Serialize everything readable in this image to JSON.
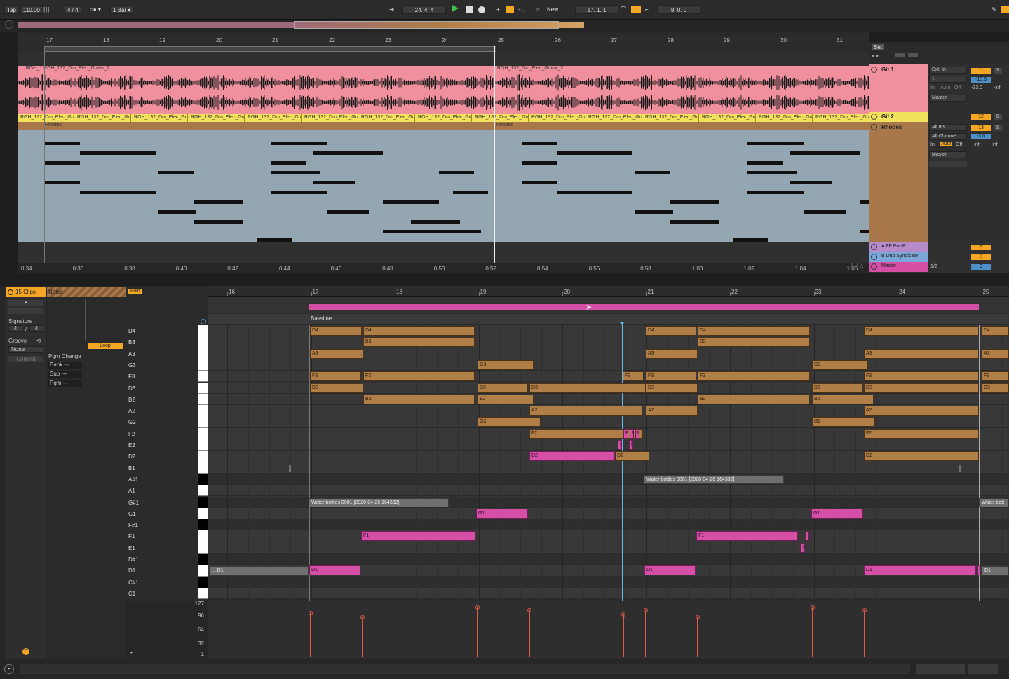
{
  "transport": {
    "tap": "Tap",
    "tempo": "110.00",
    "signature": "4 / 4",
    "quantize": "1 Bar",
    "position": "24.  4.  4",
    "new_label": "New",
    "loop_start": "17.  1.  1",
    "loop_length": "8.  0.  0"
  },
  "arrangement": {
    "bar_labels": [
      "17",
      "18",
      "19",
      "20",
      "21",
      "22",
      "23",
      "24",
      "25",
      "26",
      "27",
      "28",
      "29",
      "30",
      "31"
    ],
    "time_labels": [
      "0:34",
      "0:36",
      "0:38",
      "0:40",
      "0:42",
      "0:44",
      "0:46",
      "0:48",
      "0:50",
      "0:52",
      "0:54",
      "0:56",
      "0:58",
      "1:00",
      "1:02",
      "1:04",
      "1:06"
    ],
    "page_indicator": "1 / 4",
    "tracks": [
      {
        "name": "Git 1",
        "clip_label_a": "... RGH_1 RGH_132_Dm_Elec_Guitar_2",
        "clip_label_b": "RGH_132_Dm_Elec_Guitar_2",
        "color": "#f0909e"
      },
      {
        "name": "Git 2",
        "clip_label": "RGH_132_Dm_Elec_Gui",
        "color": "#f2e15c"
      },
      {
        "name": "Rhodes",
        "clip_label": "Rhodes",
        "color": "#a8774a"
      }
    ],
    "returns": [
      {
        "name": "A FF Pro-R",
        "letter": "A"
      },
      {
        "name": "B Dub Syndicate",
        "letter": "B"
      }
    ],
    "master": {
      "name": "Master",
      "fraction": "1/2",
      "value": "0"
    }
  },
  "mixer": {
    "git1": {
      "input": "Ext. In",
      "channel": "1",
      "monitor": [
        "In",
        "Auto",
        "Off"
      ],
      "output": "Master",
      "volume": "-10.6",
      "send": "-33.0",
      "peak": "-inf",
      "number": "11",
      "solo": "S"
    },
    "git2": {
      "number": "12",
      "solo": "S"
    },
    "rhodes": {
      "input": "All Ins",
      "channel": "All Channe",
      "monitor": [
        "In",
        "Auto",
        "Off"
      ],
      "output": "Master",
      "volume": "-3.0",
      "peak1": "-inf",
      "peak2": "-inf",
      "number": "13",
      "solo": "S"
    },
    "set_label": "Set"
  },
  "clip_panel": {
    "clips_count": "15 Clips",
    "notes_tab": "Notes",
    "signature_label": "Signature",
    "sig_num": "4",
    "sig_den": "4",
    "groove_label": "Groove",
    "groove_value": "None",
    "commit": "Commit",
    "pgm_change": "Pgm Change",
    "bank": "Bank ---",
    "sub": "Sub ---",
    "pgm": "Pgm ---",
    "loop": "Loop"
  },
  "piano_roll": {
    "fold": "Fold",
    "clip_name": "Bassline",
    "bar_labels": [
      "16",
      "17",
      "18",
      "19",
      "20",
      "21",
      "22",
      "23",
      "24",
      "25"
    ],
    "keys": [
      "D4",
      "B3",
      "A3",
      "G3",
      "F3",
      "D3",
      "B2",
      "A2",
      "G2",
      "F2",
      "E2",
      "D2",
      "B1",
      "A#1",
      "A1",
      "G#1",
      "G1",
      "F#1",
      "F1",
      "E1",
      "D#1",
      "D1",
      "C#1",
      "C1"
    ],
    "sample_clip_1": "Water bottles 0001 [2020-04-26 164332]",
    "sample_clip_2": "Water bottles 0001 [2020-04-26 164332]",
    "sample_clip_3": "Water bott",
    "d1_prev": "... D1",
    "velocity_labels": [
      "127",
      "96",
      "64",
      "32",
      "1"
    ]
  }
}
